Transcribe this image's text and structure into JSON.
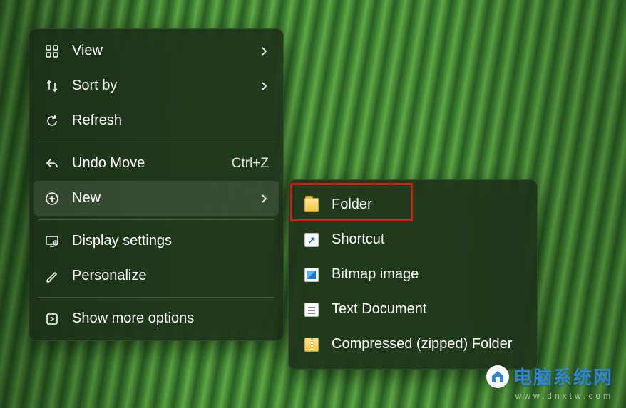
{
  "primary_menu": {
    "view": {
      "label": "View",
      "has_submenu": true
    },
    "sort_by": {
      "label": "Sort by",
      "has_submenu": true
    },
    "refresh": {
      "label": "Refresh"
    },
    "undo_move": {
      "label": "Undo Move",
      "accelerator": "Ctrl+Z"
    },
    "new": {
      "label": "New",
      "has_submenu": true,
      "hovered": true
    },
    "display_settings": {
      "label": "Display settings"
    },
    "personalize": {
      "label": "Personalize"
    },
    "show_more": {
      "label": "Show more options"
    }
  },
  "new_submenu": {
    "folder": {
      "label": "Folder",
      "highlighted": true
    },
    "shortcut": {
      "label": "Shortcut"
    },
    "bitmap": {
      "label": "Bitmap image"
    },
    "text": {
      "label": "Text Document"
    },
    "zip": {
      "label": "Compressed (zipped) Folder"
    }
  },
  "watermark": {
    "title": "电脑系统网",
    "subtitle": "www.dnxtw.com"
  }
}
